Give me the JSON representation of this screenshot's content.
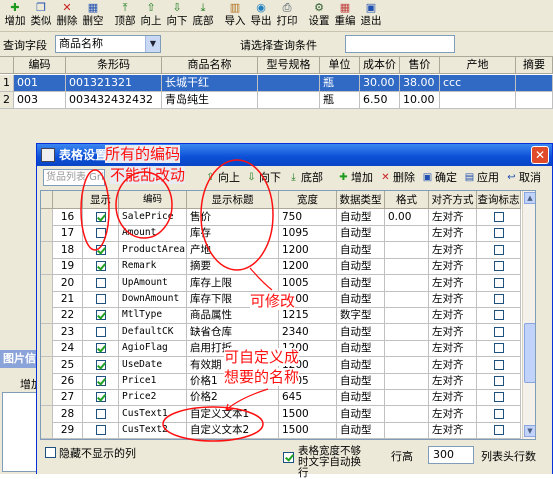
{
  "toolbar": {
    "buttons": [
      {
        "label": "增加",
        "icon": "add-icon"
      },
      {
        "label": "类似",
        "icon": "copy-icon"
      },
      {
        "label": "删除",
        "icon": "delete-icon"
      },
      {
        "label": "删空",
        "icon": "clear-icon"
      },
      {
        "label": "顶部",
        "icon": "top-icon"
      },
      {
        "label": "向上",
        "icon": "up-icon"
      },
      {
        "label": "向下",
        "icon": "down-icon"
      },
      {
        "label": "底部",
        "icon": "bottom-icon"
      },
      {
        "label": "导入",
        "icon": "import-icon"
      },
      {
        "label": "导出",
        "icon": "export-icon"
      },
      {
        "label": "打印",
        "icon": "print-icon"
      },
      {
        "label": "设置",
        "icon": "settings-icon"
      },
      {
        "label": "重编",
        "icon": "renumber-icon"
      },
      {
        "label": "退出",
        "icon": "exit-icon"
      }
    ]
  },
  "query": {
    "field_label": "查询字段",
    "field_value": "商品名称",
    "condition_label": "请选择查询条件",
    "condition_value": ""
  },
  "main_table": {
    "columns": [
      "编码",
      "条形码",
      "商品名称",
      "型号规格",
      "单位",
      "成本价",
      "售价",
      "产地",
      "摘要"
    ],
    "rows": [
      {
        "rn": "1",
        "cells": [
          "001",
          "001321321",
          "长城干红",
          "",
          "瓶",
          "30.00",
          "38.00",
          "ccc",
          ""
        ]
      },
      {
        "rn": "2",
        "cells": [
          "003",
          "003432432432",
          "青岛纯生",
          "",
          "瓶",
          "6.50",
          "10.00",
          "",
          ""
        ]
      }
    ]
  },
  "side_panel": {
    "title": "图片信息",
    "add_label": "增加"
  },
  "dialog": {
    "title": "表格设置",
    "search_placeholder": "货品列表 Gri",
    "toolbar": {
      "up": "向上",
      "down": "向下",
      "bottom": "底部",
      "add": "增加",
      "delete": "删除",
      "ok": "确定",
      "apply": "应用",
      "cancel": "取消"
    },
    "columns": [
      "显示",
      "编码",
      "显示标题",
      "宽度",
      "数据类型",
      "格式",
      "对齐方式",
      "查询标志"
    ],
    "rows": [
      {
        "no": "16",
        "show": true,
        "code": "SalePrice",
        "title": "售价",
        "width": "750",
        "type": "自动型",
        "format": "0.00",
        "align": "左对齐",
        "query": false
      },
      {
        "no": "17",
        "show": false,
        "code": "Amount",
        "title": "库存",
        "width": "1095",
        "type": "自动型",
        "format": "",
        "align": "左对齐",
        "query": false
      },
      {
        "no": "18",
        "show": true,
        "code": "ProductArea",
        "title": "产地",
        "width": "1200",
        "type": "自动型",
        "format": "",
        "align": "左对齐",
        "query": false
      },
      {
        "no": "19",
        "show": true,
        "code": "Remark",
        "title": "摘要",
        "width": "1200",
        "type": "自动型",
        "format": "",
        "align": "左对齐",
        "query": false
      },
      {
        "no": "20",
        "show": false,
        "code": "UpAmount",
        "title": "库存上限",
        "width": "1005",
        "type": "自动型",
        "format": "",
        "align": "左对齐",
        "query": false
      },
      {
        "no": "21",
        "show": false,
        "code": "DownAmount",
        "title": "库存下限",
        "width": "1200",
        "type": "自动型",
        "format": "",
        "align": "左对齐",
        "query": false
      },
      {
        "no": "22",
        "show": true,
        "code": "MtlType",
        "title": "商品属性",
        "width": "1215",
        "type": "数字型",
        "format": "",
        "align": "左对齐",
        "query": false
      },
      {
        "no": "23",
        "show": false,
        "code": "DefaultCK",
        "title": "缺省仓库",
        "width": "2340",
        "type": "自动型",
        "format": "",
        "align": "左对齐",
        "query": false
      },
      {
        "no": "24",
        "show": true,
        "code": "AgioFlag",
        "title": "启用打折",
        "width": "1200",
        "type": "自动型",
        "format": "",
        "align": "左对齐",
        "query": false
      },
      {
        "no": "25",
        "show": true,
        "code": "UseDate",
        "title": "有效期",
        "width": "1200",
        "type": "自动型",
        "format": "",
        "align": "左对齐",
        "query": false
      },
      {
        "no": "26",
        "show": true,
        "code": "Price1",
        "title": "价格1",
        "width": "1005",
        "type": "自动型",
        "format": "",
        "align": "左对齐",
        "query": false
      },
      {
        "no": "27",
        "show": true,
        "code": "Price2",
        "title": "价格2",
        "width": "645",
        "type": "自动型",
        "format": "",
        "align": "左对齐",
        "query": false
      },
      {
        "no": "28",
        "show": false,
        "code": "CusText1",
        "title": "自定义文本1",
        "width": "1500",
        "type": "自动型",
        "format": "",
        "align": "左对齐",
        "query": false
      },
      {
        "no": "29",
        "show": false,
        "code": "CusText2",
        "title": "自定义文本2",
        "width": "1500",
        "type": "自动型",
        "format": "",
        "align": "左对齐",
        "query": false
      }
    ],
    "footer": {
      "hide_label": "隐藏不显示的列",
      "auto_wrap_label": "表格宽度不够时文字自动换行",
      "auto_wrap_checked": true,
      "row_height_label": "行高",
      "row_height_value": "300",
      "header_rows_label": "列表头行数"
    }
  },
  "annotations": {
    "note1": "所有的编码",
    "note2": "不能乱改动",
    "note3": "可修改",
    "note4": "可自定义成",
    "note5": "想要的名称"
  },
  "colors": {
    "annotation": "#ff1010",
    "selection": "#316ac5",
    "title_bar": "#0b4fd6"
  }
}
